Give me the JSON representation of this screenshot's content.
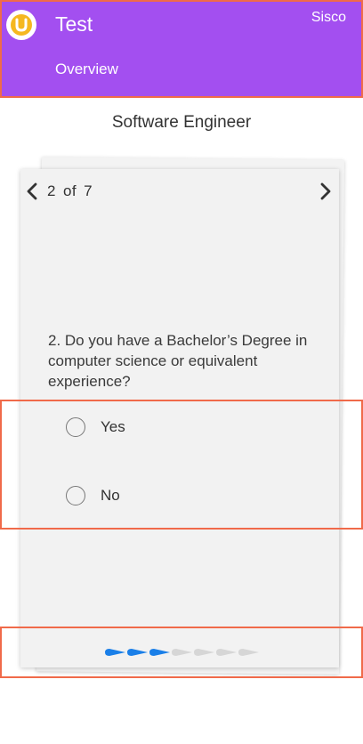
{
  "header": {
    "app_title": "Test",
    "user_name": "Sisco",
    "tab_label": "Overview",
    "bg_color": "#a34ff0",
    "logo_icon": "brand-logo-icon"
  },
  "page": {
    "title": "Software Engineer"
  },
  "pager": {
    "current": "2",
    "of_label": "of",
    "total": "7"
  },
  "question": {
    "text": "2. Do you have a Bachelor’s Degree in computer science or equivalent experience?",
    "options": [
      {
        "label": "Yes",
        "selected": false
      },
      {
        "label": "No",
        "selected": false
      }
    ]
  },
  "progress": {
    "total_steps": 7,
    "completed_steps": 3,
    "active_color": "#1a7fe8",
    "inactive_color": "#d6d6d6"
  }
}
